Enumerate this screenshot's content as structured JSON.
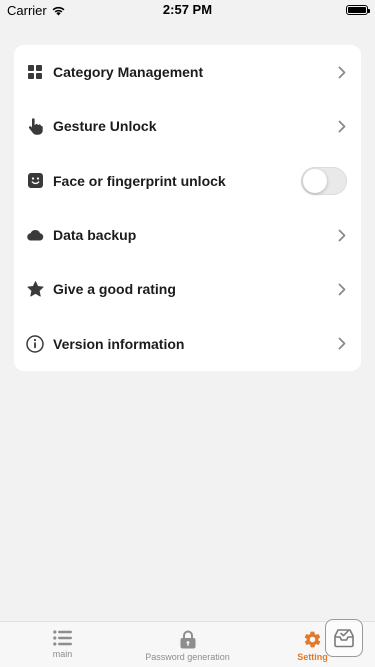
{
  "status_bar": {
    "carrier": "Carrier",
    "time": "2:57 PM"
  },
  "settings": {
    "items": [
      {
        "label": "Category Management",
        "icon": "grid-icon",
        "accessory": "chevron"
      },
      {
        "label": "Gesture Unlock",
        "icon": "hand-pointer-icon",
        "accessory": "chevron"
      },
      {
        "label": "Face or fingerprint unlock",
        "icon": "face-id-icon",
        "accessory": "toggle",
        "toggle_on": false
      },
      {
        "label": "Data backup",
        "icon": "cloud-icon",
        "accessory": "chevron"
      },
      {
        "label": "Give a good rating",
        "icon": "star-icon",
        "accessory": "chevron"
      },
      {
        "label": "Version information",
        "icon": "info-icon",
        "accessory": "chevron"
      }
    ]
  },
  "tabbar": {
    "tabs": [
      {
        "label": "main",
        "icon": "list-icon",
        "active": false
      },
      {
        "label": "Password generation",
        "icon": "lock-icon",
        "active": false
      },
      {
        "label": "Setting",
        "icon": "gear-icon",
        "active": true
      }
    ]
  },
  "colors": {
    "accent": "#e07b2d",
    "background": "#f2f2f2",
    "card": "#ffffff"
  }
}
